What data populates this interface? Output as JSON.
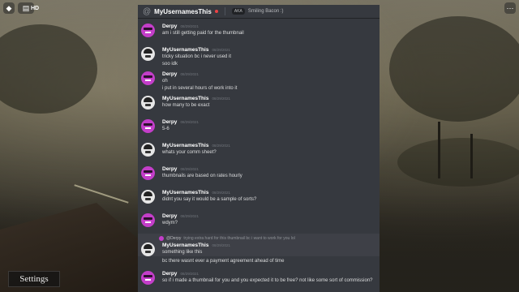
{
  "topbar": {
    "chat_badge": "HD"
  },
  "game": {
    "settings_label": "Settings"
  },
  "header": {
    "name": "MyUsernamesThis",
    "aka": "AKA",
    "alias": "Smiling Bacon :)"
  },
  "messages": [
    {
      "author": "Derpy",
      "time": "08/29/2021",
      "avatar": "derpy",
      "lines": [
        "am i still getting paid for the thumbnail"
      ]
    },
    {
      "author": "MyUsernamesThis",
      "time": "08/29/2021",
      "avatar": "user",
      "lines": [
        "tricky situation bc i never used it",
        "soo idk"
      ]
    },
    {
      "author": "Derpy",
      "time": "08/29/2021",
      "avatar": "derpy",
      "lines": [
        "oh",
        "i put in several hours of work into it"
      ]
    },
    {
      "author": "MyUsernamesThis",
      "time": "08/29/2021",
      "avatar": "user",
      "lines": [
        "how many to be exact"
      ]
    },
    {
      "author": "Derpy",
      "time": "08/29/2021",
      "avatar": "derpy",
      "lines": [
        "5-6"
      ]
    },
    {
      "author": "MyUsernamesThis",
      "time": "08/29/2021",
      "avatar": "user",
      "lines": [
        "whats your comm sheet?"
      ]
    },
    {
      "author": "Derpy",
      "time": "08/29/2021",
      "avatar": "derpy",
      "lines": [
        "thumbnails are based on rates hourly"
      ]
    },
    {
      "author": "MyUsernamesThis",
      "time": "08/29/2021",
      "avatar": "user",
      "lines": [
        "didnt you say it would be a sample of sorts?"
      ]
    },
    {
      "author": "Derpy",
      "time": "08/29/2021",
      "avatar": "derpy",
      "lines": [
        "wdym?"
      ]
    }
  ],
  "reply": {
    "target": "@Derpy",
    "snippet": "trying extra hard for this thumbnail bc i want to work for you lol",
    "author": "MyUsernamesThis",
    "time": "08/29/2021",
    "lines": [
      "something like this",
      "bc there wasnt ever a payment agreement ahead of time"
    ]
  },
  "last": {
    "author": "Derpy",
    "time": "08/29/2021",
    "line": "so if i made a thumbnail for you and you expected it to be free? not like some sort of commission?"
  }
}
